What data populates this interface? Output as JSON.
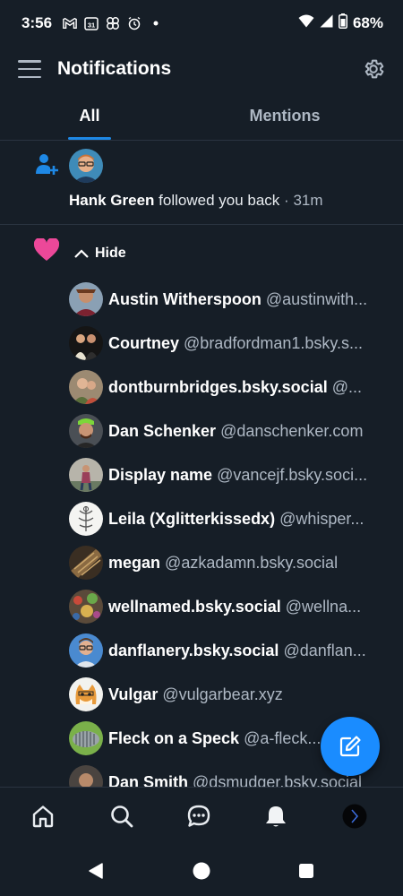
{
  "status_bar": {
    "time": "3:56",
    "battery": "68%",
    "icons": [
      "gmail-icon",
      "calendar-icon",
      "pinwheel-icon",
      "alarm-icon",
      "dot-icon",
      "wifi-icon",
      "signal-icon",
      "battery-icon"
    ],
    "calendar_day": "31"
  },
  "header": {
    "title": "Notifications"
  },
  "tabs": [
    {
      "label": "All",
      "active": true
    },
    {
      "label": "Mentions",
      "active": false
    }
  ],
  "follow_notification": {
    "name": "Hank Green",
    "action": "followed you back",
    "separator": "·",
    "time": "31m"
  },
  "likes_group": {
    "toggle_label": "Hide",
    "users": [
      {
        "name": "Austin Witherspoon",
        "handle": "@austinwith..."
      },
      {
        "name": "Courtney",
        "handle": "@bradfordman1.bsky.s..."
      },
      {
        "name": "dontburnbridges.bsky.social",
        "handle": "@..."
      },
      {
        "name": "Dan Schenker",
        "handle": "@danschenker.com"
      },
      {
        "name": "Display name",
        "handle": "@vancejf.bsky.soci..."
      },
      {
        "name": "Leila (Xglitterkissedx)",
        "handle": "@whisper..."
      },
      {
        "name": "megan",
        "handle": "@azkadamn.bsky.social"
      },
      {
        "name": "wellnamed.bsky.social",
        "handle": "@wellna..."
      },
      {
        "name": "danflanery.bsky.social",
        "handle": "@danflan..."
      },
      {
        "name": "Vulgar",
        "handle": "@vulgarbear.xyz"
      },
      {
        "name": "Fleck on a Speck",
        "handle": "@a-fleck..."
      },
      {
        "name": "Dan Smith",
        "handle": "@dsmudger.bsky.social"
      }
    ]
  },
  "colors": {
    "background": "#161e27",
    "accent": "#1a8cff",
    "like_heart": "#ec4899",
    "follow_icon": "#1e88e5"
  }
}
